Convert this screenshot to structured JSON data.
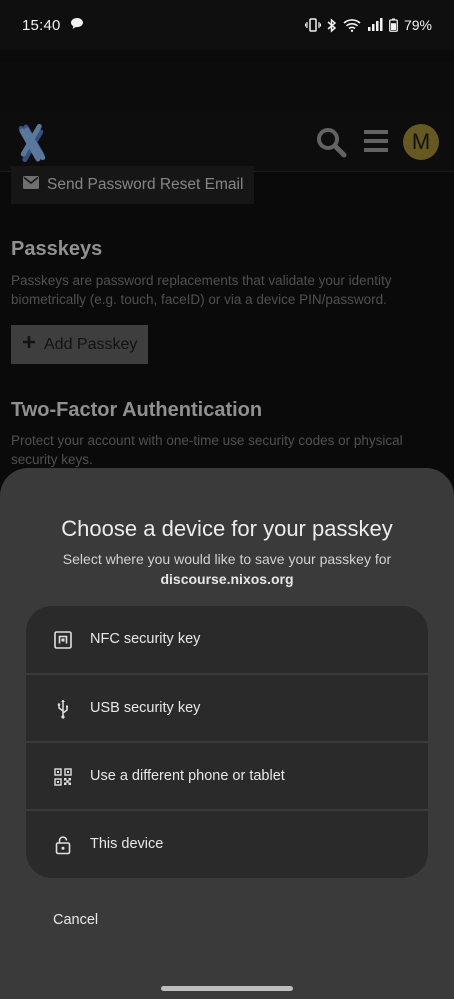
{
  "status_bar": {
    "time": "15:40",
    "battery_percent": "79%",
    "icons": [
      "chat-bubble-icon",
      "vibrate-icon",
      "bluetooth-icon",
      "wifi-icon",
      "signal-icon",
      "battery-icon"
    ]
  },
  "header": {
    "logo": "nixos-logo",
    "avatar_letter": "M",
    "avatar_color": "#8c7a2e"
  },
  "page": {
    "reset_button_label": "Send Password Reset Email",
    "passkeys_title": "Passkeys",
    "passkeys_description": "Passkeys are password replacements that validate your identity biometrically (e.g. touch, faceID) or via a device PIN/password.",
    "add_passkey_label": "Add Passkey",
    "twofa_title": "Two-Factor Authentication",
    "twofa_description": "Protect your account with one-time use security codes or physical security keys."
  },
  "sheet": {
    "title": "Choose a device for your passkey",
    "subtitle": "Select where you would like to save your passkey for",
    "domain": "discourse.nixos.org",
    "options": [
      {
        "label": "NFC security key",
        "icon": "nfc-icon"
      },
      {
        "label": "USB security key",
        "icon": "usb-icon"
      },
      {
        "label": "Use a different phone or tablet",
        "icon": "qr-code-icon"
      },
      {
        "label": "This device",
        "icon": "lock-icon"
      }
    ],
    "cancel_label": "Cancel"
  }
}
